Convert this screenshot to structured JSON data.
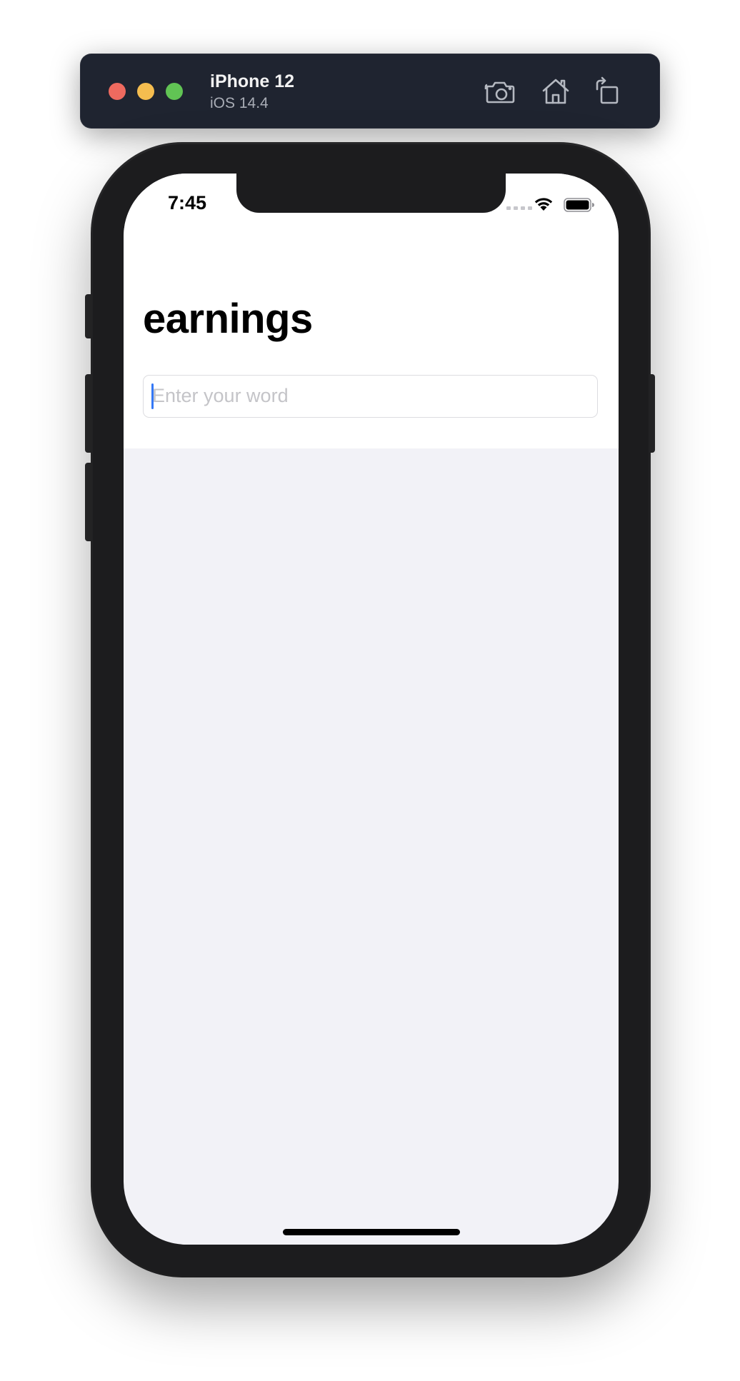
{
  "simulator": {
    "device_name": "iPhone 12",
    "os_version": "iOS 14.4",
    "toolbar_icons": [
      "screenshot-camera-icon",
      "home-icon",
      "rotate-icon"
    ]
  },
  "status_bar": {
    "time": "7:45",
    "icons": [
      "cellular-signal-icon",
      "wifi-icon",
      "battery-icon"
    ]
  },
  "page": {
    "title": "earnings"
  },
  "search": {
    "placeholder": "Enter your word",
    "value": ""
  },
  "colors": {
    "close": "#ee6a5f",
    "minimize": "#f5bd4f",
    "maximize": "#61c454",
    "caret": "#3478f6",
    "list_background": "#f2f2f7"
  }
}
